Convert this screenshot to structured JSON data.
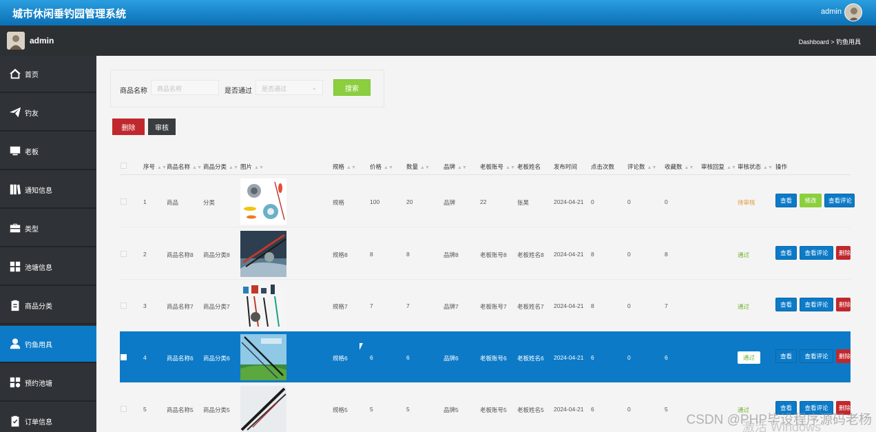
{
  "app": {
    "title": "城市休闲垂钓园管理系统",
    "user": "admin"
  },
  "subbar": {
    "user": "admin",
    "breadcrumb": "Dashboard > 钓鱼用具"
  },
  "sidebar": {
    "items": [
      {
        "label": "首页",
        "icon": "home-icon"
      },
      {
        "label": "钓友",
        "icon": "send-icon"
      },
      {
        "label": "老板",
        "icon": "monitor-icon"
      },
      {
        "label": "通知信息",
        "icon": "book-icon"
      },
      {
        "label": "类型",
        "icon": "briefcase-icon"
      },
      {
        "label": "池塘信息",
        "icon": "grid-icon"
      },
      {
        "label": "商品分类",
        "icon": "clipboard-icon"
      },
      {
        "label": "钓鱼用具",
        "icon": "user-icon",
        "active": true
      },
      {
        "label": "预约池塘",
        "icon": "apps-icon"
      },
      {
        "label": "订单信息",
        "icon": "checklist-icon"
      }
    ]
  },
  "search": {
    "name_label": "商品名称",
    "name_placeholder": "商品名称",
    "pass_label": "是否通过",
    "pass_placeholder": "是否通过",
    "button": "搜索"
  },
  "toolbar": {
    "delete": "删除",
    "audit": "审核"
  },
  "table": {
    "headers": [
      "序号",
      "商品名称",
      "商品分类",
      "图片",
      "规格",
      "价格",
      "数量",
      "品牌",
      "老板账号",
      "老板姓名",
      "发布时间",
      "点击次数",
      "评论数",
      "收藏数",
      "审核回复",
      "审核状态",
      "操作"
    ],
    "rows": [
      {
        "no": "1",
        "name": "商品",
        "cat": "分类",
        "spec": "规格",
        "price": "100",
        "qty": "20",
        "brand": "品牌",
        "acct": "22",
        "owner": "张昊",
        "time": "2024-04-21",
        "clicks": "0",
        "comments": "0",
        "favs": "0",
        "status": "待审核",
        "status_color": "#e09a3c",
        "actions": [
          "查看",
          "修改",
          "查看评论"
        ]
      },
      {
        "no": "2",
        "name": "商品名称8",
        "cat": "商品分类8",
        "spec": "规格8",
        "price": "8",
        "qty": "8",
        "brand": "品牌8",
        "acct": "老板账号8",
        "owner": "老板姓名8",
        "time": "2024-04-21",
        "clicks": "8",
        "comments": "0",
        "favs": "8",
        "status": "通过",
        "status_color": "#6fb22b",
        "actions": [
          "查看",
          "查看评论",
          "删除"
        ]
      },
      {
        "no": "3",
        "name": "商品名称7",
        "cat": "商品分类7",
        "spec": "规格7",
        "price": "7",
        "qty": "7",
        "brand": "品牌7",
        "acct": "老板账号7",
        "owner": "老板姓名7",
        "time": "2024-04-21",
        "clicks": "8",
        "comments": "0",
        "favs": "7",
        "status": "通过",
        "status_color": "#6fb22b",
        "actions": [
          "查看",
          "查看评论",
          "删除"
        ]
      },
      {
        "no": "4",
        "name": "商品名称6",
        "cat": "商品分类6",
        "spec": "规格6",
        "price": "6",
        "qty": "6",
        "brand": "品牌6",
        "acct": "老板账号6",
        "owner": "老板姓名6",
        "time": "2024-04-21",
        "clicks": "6",
        "comments": "0",
        "favs": "6",
        "status": "通过",
        "status_color": "#6fb22b",
        "actions": [
          "查看",
          "查看评论",
          "删除"
        ]
      },
      {
        "no": "5",
        "name": "商品名称5",
        "cat": "商品分类5",
        "spec": "规格5",
        "price": "5",
        "qty": "5",
        "brand": "品牌5",
        "acct": "老板账号5",
        "owner": "老板姓名5",
        "time": "2024-04-21",
        "clicks": "6",
        "comments": "0",
        "favs": "5",
        "status": "通过",
        "status_color": "#6fb22b",
        "actions": [
          "查看",
          "查看评论",
          "删除"
        ]
      }
    ]
  },
  "watermark": {
    "csdn": "CSDN @PHP毕设程序源码老杨",
    "windows": "激活 Windows"
  }
}
